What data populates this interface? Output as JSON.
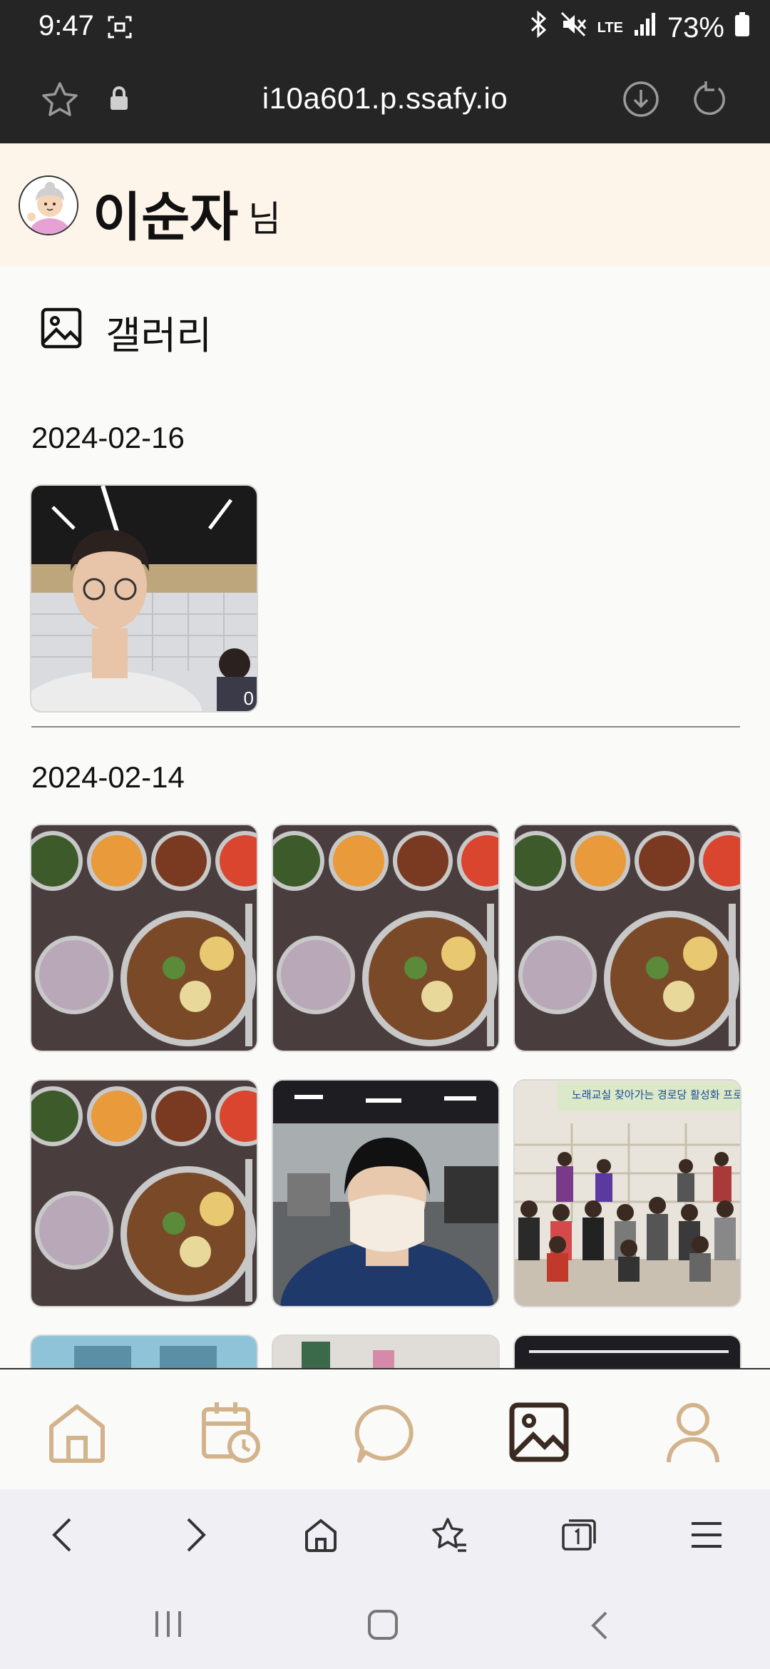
{
  "status_bar": {
    "time": "9:47",
    "network": "LTE",
    "battery": "73%"
  },
  "browser": {
    "url": "i10a601.p.ssafy.io"
  },
  "profile": {
    "name": "이순자",
    "suffix": "님"
  },
  "section": {
    "title": "갤러리"
  },
  "groups": [
    {
      "date": "2024-02-16",
      "photos": [
        {
          "subject": "person-in-office",
          "badge": "0"
        }
      ]
    },
    {
      "date": "2024-02-14",
      "photos": [
        {
          "subject": "meal-tray"
        },
        {
          "subject": "meal-tray"
        },
        {
          "subject": "meal-tray"
        },
        {
          "subject": "meal-tray"
        },
        {
          "subject": "person-with-mask"
        },
        {
          "subject": "group-photo",
          "banner": "노래교실 찾아가는 경로당 활성화 프로"
        }
      ]
    }
  ],
  "bottom_nav": [
    {
      "name": "home",
      "active": false
    },
    {
      "name": "calendar",
      "active": false
    },
    {
      "name": "chat",
      "active": false
    },
    {
      "name": "gallery",
      "active": true
    },
    {
      "name": "profile",
      "active": false
    }
  ],
  "colors": {
    "nav_inactive": "#d3b38c",
    "nav_active": "#3a2a22",
    "header_bg": "#fdf5ea",
    "tray": "#4a3d3d"
  }
}
